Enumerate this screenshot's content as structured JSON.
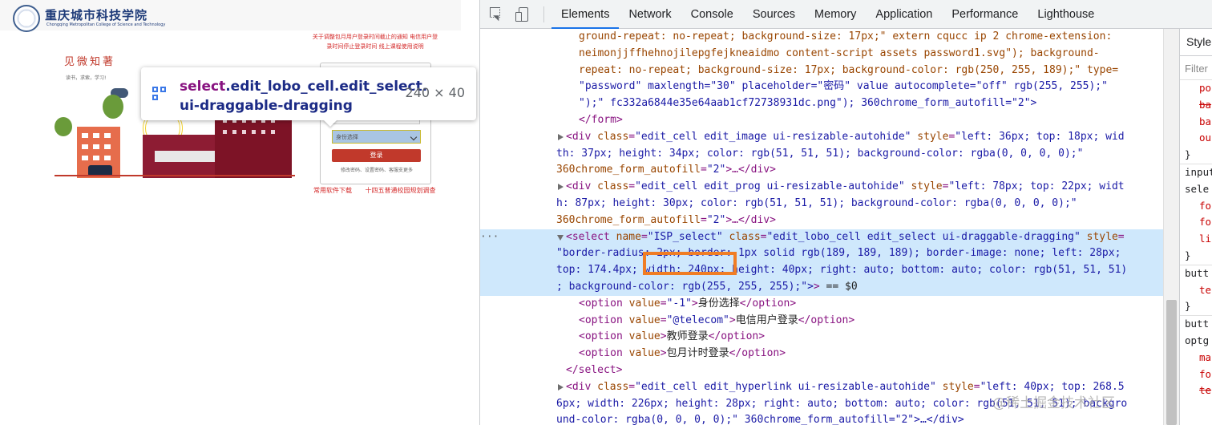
{
  "preview": {
    "logo_text": "重庆城市科技学院",
    "logo_sub": "Chongqing Metropolitan College of Science and Technology",
    "notice_text": "关于调整包月用户登录时间截止的通知 电信用户登录时间停止登录时间 线上课程使用说明",
    "motto": "见微知著",
    "motto_sub": "读书，求索，学习!",
    "login_select_label": "身份选择",
    "login_button": "登录",
    "login_links": "修改密码、设置密码、客服支更多",
    "bottom_links": [
      "常用软件下载",
      "十四五普通校园规划调查"
    ]
  },
  "tooltip": {
    "tag": "select",
    "classes": ".edit_lobo_cell.edit_select.",
    "classes_line2": "ui-draggable-dragging",
    "size": "240 × 40"
  },
  "devtools": {
    "tabs": [
      "Elements",
      "Network",
      "Console",
      "Sources",
      "Memory",
      "Application",
      "Performance",
      "Lighthouse"
    ],
    "active_tab": "Elements",
    "styles_title": "Style",
    "styles_filter": "Filter"
  },
  "dom": {
    "l1": "ground-repeat: no-repeat; background-size: 17px;\" extern cqucc ip 2 chrome-extension:",
    "l2": "neimonjjffhehnojilepgfejkneaidmo content-script assets password1.svg\"); background-",
    "l3": "repeat: no-repeat; background-size: 17px; background-color: rgb(250, 255, 189);\" type=",
    "l4": "\"password\" maxlength=\"30\" placeholder=\"密码\" value autocomplete=\"off\" rgb(255, 255);\"",
    "l5": "\");\" fc332a6844e35e64aab1cf72738931dc.png\"); 360chrome_form_autofill=\"2\">",
    "l6": "</form>",
    "l7_a": "<div ",
    "l7_an": "class",
    "l7_av": "\"edit_cell edit_image ui-resizable-autohide\"",
    "l7_bn": " style",
    "l7_bv": "\"left: 36px; top: 18px; wid",
    "l8": "th: 37px; height: 34px; color: rgb(51, 51, 51); background-color: rgba(0, 0, 0, 0);\"",
    "l9_a": "360chrome_form_autofill",
    "l9_b": "\"2\"",
    "l9_c": ">…</div>",
    "l10_a": "<div ",
    "l10_an": "class",
    "l10_av": "\"edit_cell edit_prog ui-resizable-autohide\"",
    "l10_bn": " style",
    "l10_bv": "\"left: 78px; top: 22px; widt",
    "l11": "h: 87px; height: 30px; color: rgb(51, 51, 51); background-color: rgba(0, 0, 0, 0);\"",
    "l12_a": "360chrome_form_autofill",
    "l12_b": "\"2\"",
    "l12_c": ">…</div>",
    "l13_dots": "···",
    "l13_a": "<select ",
    "l13_an": "name",
    "l13_av": "\"ISP_select\"",
    "l13_bn": " class",
    "l13_bv": "\"edit_lobo_cell edit_select ui-draggable-dragging\"",
    "l13_cn": " style",
    "l13_cv": "=",
    "l14": "\"border-radius: 2px; border: 1px solid rgb(189, 189, 189); border-image: none; left: 28px;",
    "l15": "top: 174.4px; width: 240px; height: 40px; right: auto; bottom: auto; color: rgb(51, 51, 51)",
    "l16": "; background-color: rgb(255, 255, 255);\">",
    "l16_eq": " == $0",
    "opt1_v": "\"-1\"",
    "opt1_t": "身份选择",
    "opt2_v": "\"@telecom\"",
    "opt2_t": "电信用户登录",
    "opt3_t": "教师登录",
    "opt4_t": "包月计时登录",
    "l21": "</select>",
    "l22_a": "<div ",
    "l22_an": "class",
    "l22_av": "\"edit_cell edit_hyperlink ui-resizable-autohide\"",
    "l22_bn": " style",
    "l22_bv": "\"left: 40px; top: 268.5",
    "l23": "6px; width: 226px; height: 28px; right: auto; bottom: auto; color: rgb(51, 51, 51); backgro",
    "l24": "und-color: rgba(0, 0, 0, 0);\" 360chrome_form_autofill=\"2\">…</div>"
  },
  "styles": {
    "lines": [
      "po",
      "ba",
      "ba",
      "ou",
      "}",
      "input",
      "sele",
      "fo",
      "fo",
      "li",
      "}",
      "butt",
      "te",
      "}",
      "butt",
      "optg",
      "ma",
      "fo",
      "te"
    ]
  },
  "watermark": "@稀土掘金技术社区"
}
